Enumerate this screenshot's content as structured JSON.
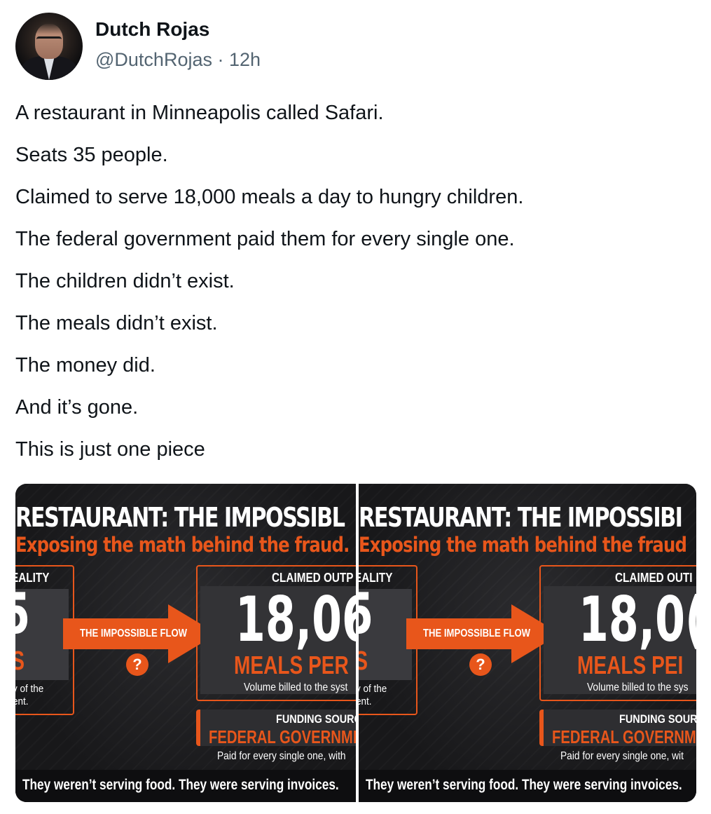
{
  "author": {
    "name": "Dutch Rojas",
    "handle": "@DutchRojas",
    "separator": "·",
    "time": "12h"
  },
  "tweet": {
    "lines": [
      "A restaurant in Minneapolis called Safari.",
      "Seats 35 people.",
      "Claimed to serve 18,000 meals a day to hungry children.",
      "The federal government paid them for every single one.",
      "The children didn’t exist.",
      "The meals didn’t exist.",
      "The money did.",
      "And it’s gone.",
      "This is just one piece"
    ]
  },
  "media": {
    "panels": [
      {
        "title": "RESTAURANT: THE IMPOSSIBL",
        "subtitle": "Exposing the math behind the fraud.",
        "reality_label": "EALITY",
        "reality_number": "5",
        "reality_unit": "S",
        "reality_desc_1": "y of the",
        "reality_desc_2": "ent.",
        "flow_label": "THE IMPOSSIBLE FLOW",
        "question": "?",
        "claimed_label": "CLAIMED OUTP",
        "claimed_number": "18,06",
        "claimed_unit": "MEALS PER",
        "claimed_desc": "Volume billed to the syst",
        "funding_label": "FUNDING SOURC",
        "funding_value": "FEDERAL GOVERNMEN",
        "funding_desc": "Paid for every single one, with",
        "footer": "They weren’t serving food. They were serving invoices."
      },
      {
        "title": "RESTAURANT: THE IMPOSSIBI",
        "subtitle": "Exposing the math behind the fraud",
        "reality_label": "EALITY",
        "reality_number": "5",
        "reality_unit": "S",
        "reality_desc_1": "y of the",
        "reality_desc_2": "ent.",
        "flow_label": "THE IMPOSSIBLE FLOW",
        "question": "?",
        "claimed_label": "CLAIMED OUTI",
        "claimed_number": "18,0(",
        "claimed_unit": "MEALS PEI",
        "claimed_desc": "Volume billed to the sys",
        "funding_label": "FUNDING SOUR",
        "funding_value": "FEDERAL GOVERNMEI",
        "funding_desc": "Paid for every single one, wit",
        "footer": "They weren’t serving food. They were serving invoices."
      }
    ]
  },
  "colors": {
    "accent": "#e8561b",
    "dark_bg": "#1d1d1f",
    "text": "#0f1419",
    "secondary": "#536471"
  }
}
